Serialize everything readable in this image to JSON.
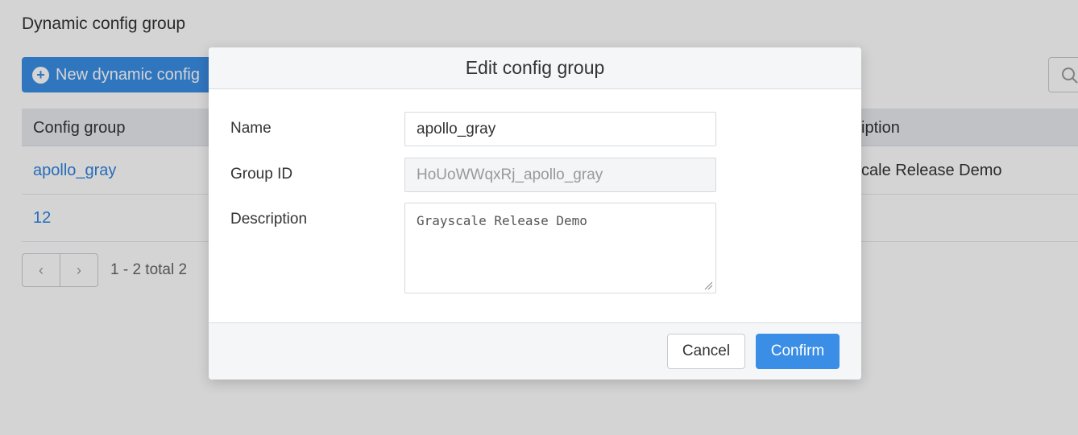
{
  "page": {
    "title": "Dynamic config group",
    "new_button_label": "New dynamic config",
    "table": {
      "columns": [
        "Config group",
        "iption"
      ],
      "rows": [
        {
          "name": "apollo_gray",
          "description": "cale Release Demo"
        },
        {
          "name": "12",
          "description": ""
        }
      ]
    },
    "pagination": {
      "prev": "‹",
      "next": "›",
      "info": "1 - 2 total 2"
    }
  },
  "modal": {
    "title": "Edit config group",
    "fields": {
      "name_label": "Name",
      "name_value": "apollo_gray",
      "group_id_label": "Group ID",
      "group_id_value": "HoUoWWqxRj_apollo_gray",
      "description_label": "Description",
      "description_value": "Grayscale Release Demo"
    },
    "cancel_label": "Cancel",
    "confirm_label": "Confirm"
  },
  "colors": {
    "primary": "#3a8ee6",
    "link": "#2f82e0",
    "overlay": "rgba(0,0,0,0.17)"
  }
}
